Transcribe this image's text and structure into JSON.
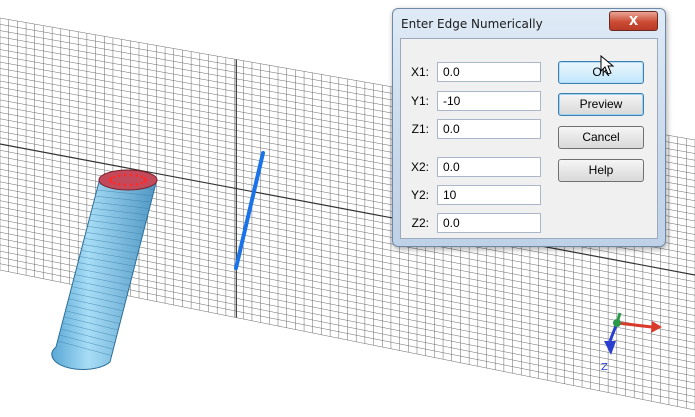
{
  "dialog": {
    "title": "Enter Edge Numerically",
    "close_label": "X",
    "fields": [
      {
        "label": "X1:",
        "value": "0.0"
      },
      {
        "label": "Y1:",
        "value": "-10"
      },
      {
        "label": "Z1:",
        "value": "0.0"
      },
      {
        "label": "X2:",
        "value": "0.0"
      },
      {
        "label": "Y2:",
        "value": "10"
      },
      {
        "label": "Z2:",
        "value": "0.0"
      }
    ],
    "buttons": {
      "ok": "OK",
      "preview": "Preview",
      "cancel": "Cancel",
      "help": "Help"
    }
  },
  "axes": {
    "z_label": "Z"
  },
  "colors": {
    "edge": "#1a73e8",
    "cylinder": "#7fc4e8",
    "axis_x": "#d93b2b",
    "axis_y": "#2a9a4a",
    "axis_z": "#2a3fcf",
    "grid": "#6a6a6a"
  },
  "icons": {
    "cursor": "mouse-pointer-icon",
    "triad": "axis-triad-icon"
  }
}
